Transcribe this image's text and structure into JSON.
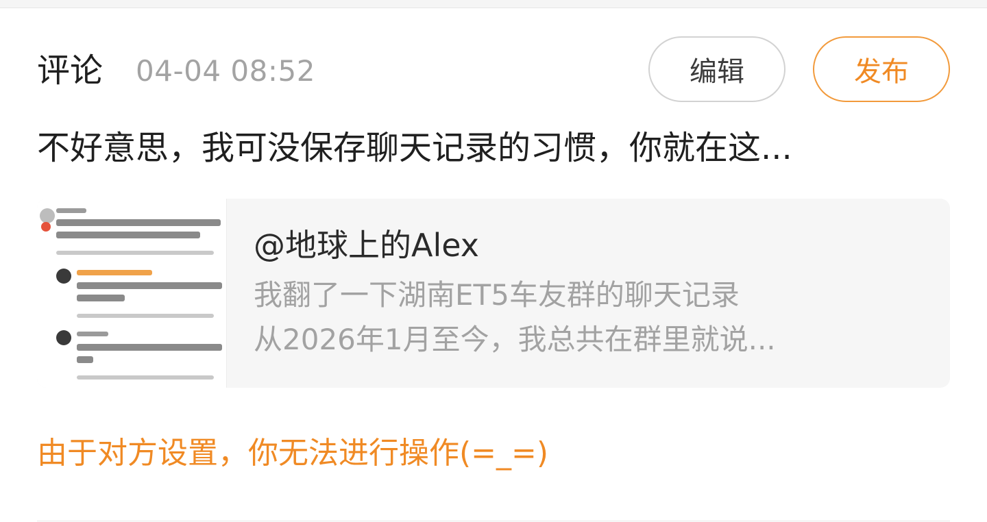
{
  "header": {
    "title": "评论",
    "time": "04-04 08:52",
    "edit_label": "编辑",
    "publish_label": "发布"
  },
  "comment": {
    "text": "不好意思，我可没保存聊天记录的习惯，你就在这..."
  },
  "quote": {
    "author": "@地球上的Alex",
    "line1": "我翻了一下湖南ET5车友群的聊天记录",
    "line2": "从2026年1月至今，我总共在群里就说..."
  },
  "restriction_notice": "由于对方设置，你无法进行操作(=_=)",
  "colors": {
    "accent": "#f08a24",
    "text_primary": "#1f1f1f",
    "text_secondary": "#a3a3a3"
  }
}
